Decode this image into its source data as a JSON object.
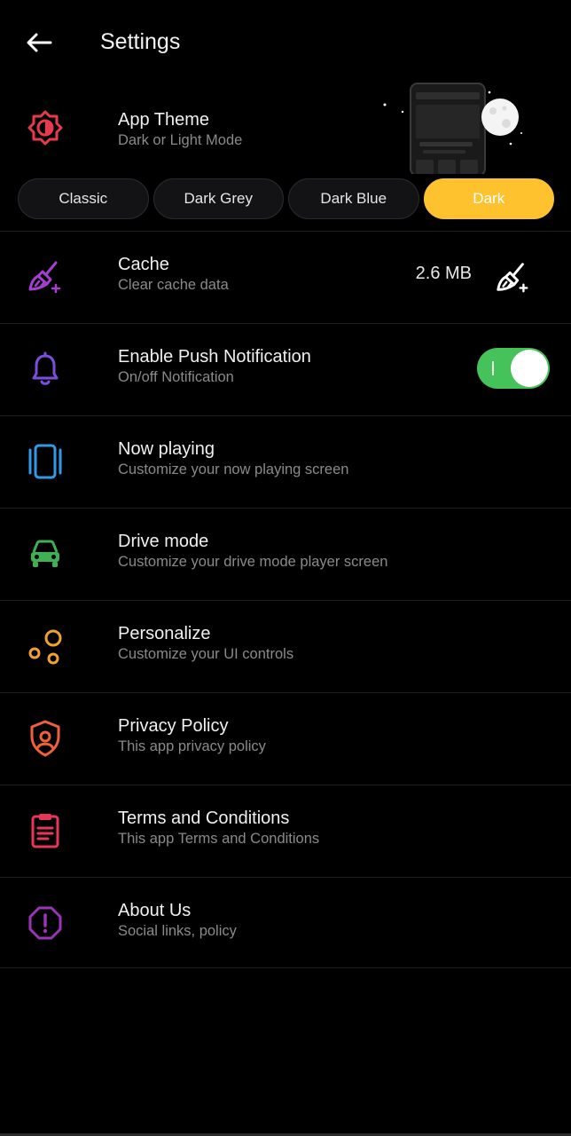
{
  "header": {
    "title": "Settings"
  },
  "theme": {
    "title": "App Theme",
    "subtitle": "Dark or Light Mode",
    "icon_color": "#e83a4c",
    "options": [
      "Classic",
      "Dark Grey",
      "Dark Blue",
      "Dark"
    ],
    "selected": "Dark",
    "accent": "#fdc22e"
  },
  "cache": {
    "title": "Cache",
    "subtitle": "Clear cache data",
    "size": "2.6 MB",
    "icon_color": "#a53fd1"
  },
  "notification": {
    "title": "Enable Push Notification",
    "subtitle": "On/off Notification",
    "enabled": true,
    "icon_color": "#7a4fe0",
    "toggle_color": "#45c25a"
  },
  "items": [
    {
      "title": "Now playing",
      "subtitle": "Customize your now playing screen",
      "icon": "now-playing-icon",
      "color": "#2f9be8"
    },
    {
      "title": "Drive mode",
      "subtitle": "Customize your drive mode player screen",
      "icon": "car-icon",
      "color": "#3fb152"
    },
    {
      "title": "Personalize",
      "subtitle": "Customize your UI controls",
      "icon": "bubbles-icon",
      "color": "#f0a32c"
    },
    {
      "title": "Privacy Policy",
      "subtitle": "This app privacy policy",
      "icon": "shield-icon",
      "color": "#f0613a"
    },
    {
      "title": "Terms and Conditions",
      "subtitle": "This app Terms and Conditions",
      "icon": "clipboard-icon",
      "color": "#e8365a"
    },
    {
      "title": "About Us",
      "subtitle": "Social links, policy",
      "icon": "info-octagon-icon",
      "color": "#9b34b8"
    }
  ]
}
